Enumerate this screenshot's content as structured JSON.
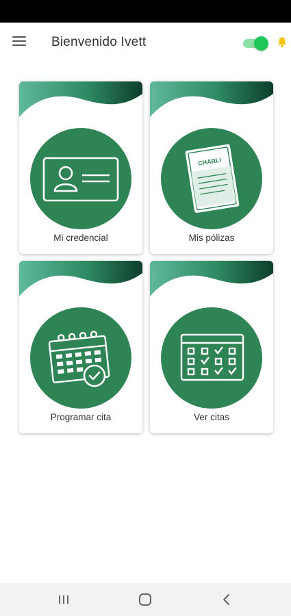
{
  "header": {
    "title": "Bienvenido Ivett",
    "menu_icon": "hamburger-menu-icon",
    "toggle_on": true,
    "toggle_color": "#1fc65a",
    "bell_icon": "bell-icon",
    "bell_color": "#f5c400"
  },
  "theme": {
    "primary": "#2e8454",
    "wave_dark": "#0d3d2a",
    "wave_light": "#5fb89a"
  },
  "cards": [
    {
      "label": "Mi credencial",
      "icon": "id-card-icon"
    },
    {
      "label": "Mis pólizas",
      "icon": "policy-document-icon",
      "doc_text": "CHARLI"
    },
    {
      "label": "Programar cita",
      "icon": "calendar-clock-icon"
    },
    {
      "label": "Ver citas",
      "icon": "calendar-checklist-icon"
    }
  ],
  "nav": {
    "recents_icon": "recent-apps-icon",
    "home_icon": "home-icon",
    "back_icon": "back-icon"
  }
}
